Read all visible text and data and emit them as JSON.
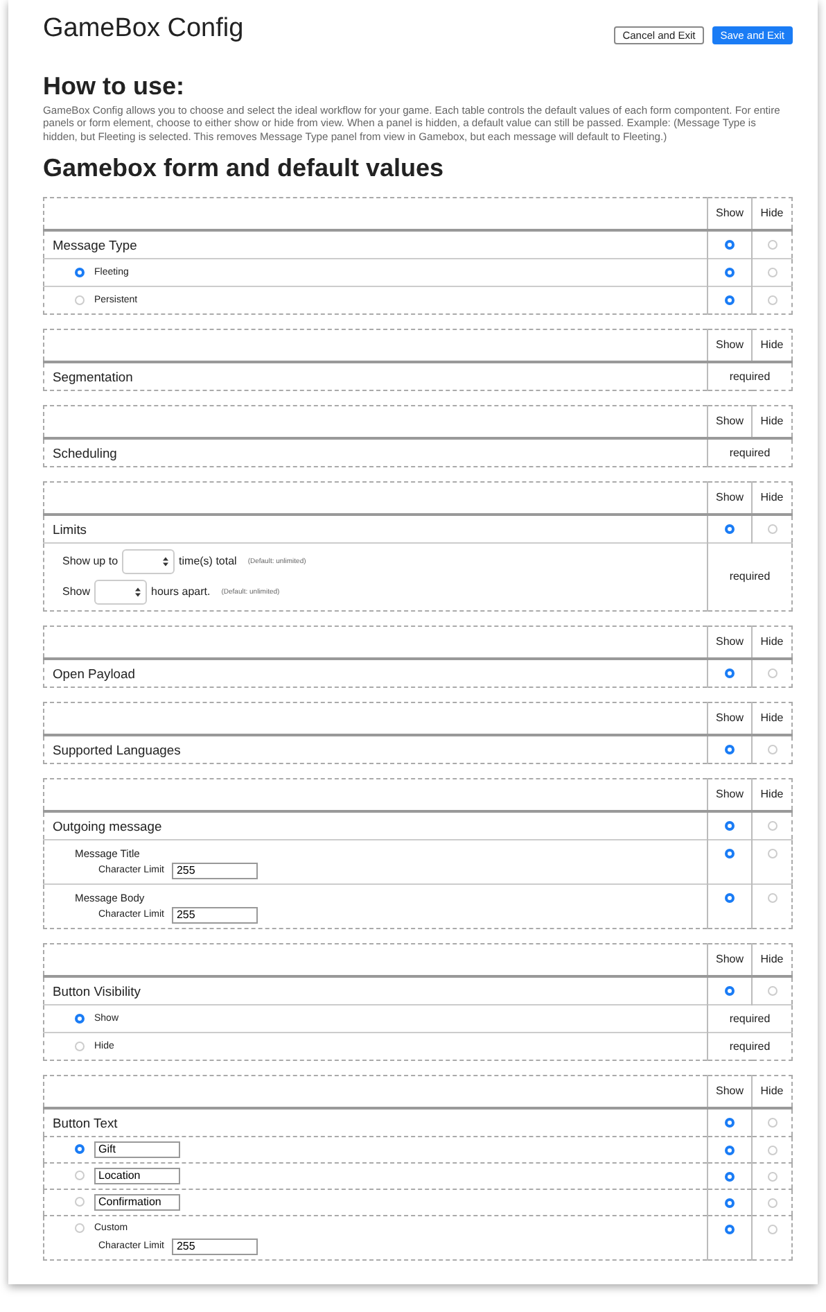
{
  "title": "GameBox Config",
  "buttons": [
    {
      "label": "Cancel and Exit",
      "kind": "secondary"
    },
    {
      "label": "Save and Exit",
      "kind": "primary"
    }
  ],
  "how_to": {
    "heading": "How to use:",
    "text": "GameBox Config allows you to choose and select the ideal workflow for your game. Each table controls the default values of each form compontent. For entire panels or form element, choose to either show or hide from view. When a panel is hidden, a default value can still be passed. Example: (Message Type is hidden, but Fleeting is selected. This removes Message Type panel from view in Gamebox, but each message will default to Fleeting.)"
  },
  "form_heading": "Gamebox form and default values",
  "panels": [
    {
      "show_label": "Show",
      "hide_label": "Hide",
      "title": "Message Type",
      "shown": true,
      "rows": [
        {
          "kind": "option",
          "label": "Fleeting",
          "selected": true,
          "shown": true
        },
        {
          "kind": "option",
          "label": "Persistent",
          "selected": false,
          "shown": true
        }
      ]
    },
    {
      "show_label": "Show",
      "hide_label": "Hide",
      "title": "Segmentation",
      "required": "required"
    },
    {
      "show_label": "Show",
      "hide_label": "Hide",
      "title": "Scheduling",
      "required": "required"
    },
    {
      "show_label": "Show",
      "hide_label": "Hide",
      "title": "Limits",
      "shown": true,
      "rows": [
        {
          "kind": "limits",
          "required": "required",
          "lines": [
            {
              "before": "Show up to",
              "after": "time(s) total",
              "note": "(Default: unlimited)"
            },
            {
              "before": "Show",
              "after": "hours apart.",
              "note": "(Default: unlimited)"
            }
          ]
        }
      ]
    },
    {
      "show_label": "Show",
      "hide_label": "Hide",
      "title": "Open Payload",
      "shown": true
    },
    {
      "show_label": "Show",
      "hide_label": "Hide",
      "title": "Supported Languages",
      "shown": true
    },
    {
      "show_label": "Show",
      "hide_label": "Hide",
      "title": "Outgoing message",
      "shown": true,
      "rows": [
        {
          "kind": "field",
          "label": "Message Title",
          "limit_label": "Character Limit",
          "value": "255",
          "shown": true
        },
        {
          "kind": "field",
          "label": "Message Body",
          "limit_label": "Character Limit",
          "value": "255",
          "shown": true
        }
      ]
    },
    {
      "show_label": "Show",
      "hide_label": "Hide",
      "title": "Button Visibility",
      "shown": true,
      "rows": [
        {
          "kind": "option",
          "label": "Show",
          "selected": true,
          "required": "required"
        },
        {
          "kind": "option",
          "label": "Hide",
          "selected": false,
          "required": "required"
        }
      ]
    },
    {
      "show_label": "Show",
      "hide_label": "Hide",
      "title": "Button Text",
      "shown": true,
      "rows": [
        {
          "kind": "text_option",
          "value": "Gift",
          "selected": true,
          "shown": true
        },
        {
          "kind": "text_option",
          "value": "Location",
          "selected": false,
          "shown": true
        },
        {
          "kind": "text_option",
          "value": "Confirmation",
          "selected": false,
          "shown": true
        },
        {
          "kind": "custom",
          "label": "Custom",
          "selected": false,
          "limit_label": "Character Limit",
          "value": "255",
          "shown": true
        }
      ]
    }
  ]
}
